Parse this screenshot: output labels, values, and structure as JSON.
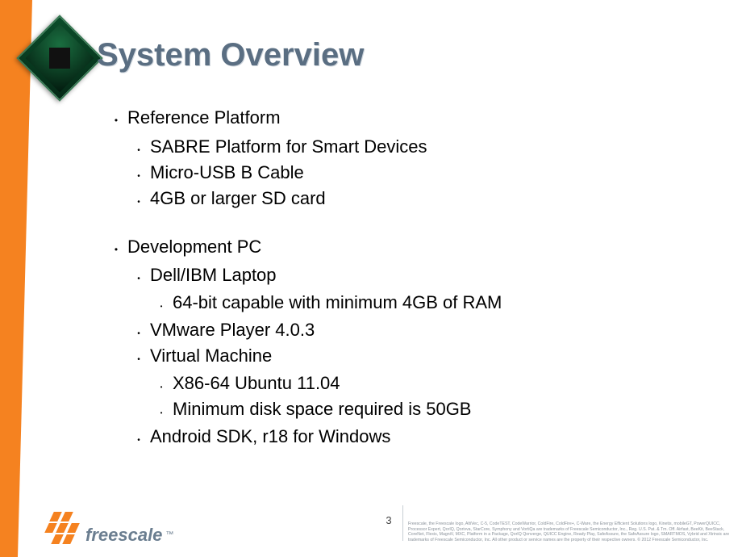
{
  "slide": {
    "title": "System Overview",
    "bullets": [
      {
        "text": "Reference Platform",
        "children": [
          {
            "text": "SABRE Platform for Smart Devices"
          },
          {
            "text": "Micro-USB B Cable"
          },
          {
            "text": "4GB or larger SD card"
          }
        ]
      },
      {
        "text": "Development PC",
        "children": [
          {
            "text": "Dell/IBM Laptop",
            "children": [
              {
                "text": "64-bit capable with minimum 4GB of RAM"
              }
            ]
          },
          {
            "text": "VMware Player 4.0.3"
          },
          {
            "text": "Virtual Machine",
            "children": [
              {
                "text": "X86-64 Ubuntu 11.04"
              },
              {
                "text": "Minimum disk space required is 50GB"
              }
            ]
          },
          {
            "text": "Android SDK, r18 for Windows"
          }
        ]
      }
    ]
  },
  "footer": {
    "brand": "freescale",
    "tm": "™",
    "page_number": "3",
    "legal": "Freescale, the Freescale logo, AltiVec, C-5, CodeTEST, CodeWarrior, ColdFire, ColdFire+, C-Ware, the Energy Efficient Solutions logo, Kinetis, mobileGT, PowerQUICC, Processor Expert, QorIQ, Qorivva, StarCore, Symphony and VortiQa are trademarks of Freescale Semiconductor, Inc., Reg. U.S. Pat. & Tm. Off. Airfast, BeeKit, BeeStack, CoreNet, Flexis, MagniV, MXC, Platform in a Package, QorIQ Qonverge, QUICC Engine, Ready Play, SafeAssure, the SafeAssure logo, SMARTMOS, Vybrid and Xtrinsic are trademarks of Freescale Semiconductor, Inc. All other product or service names are the property of their respective owners. © 2012 Freescale Semiconductor, Inc."
  }
}
